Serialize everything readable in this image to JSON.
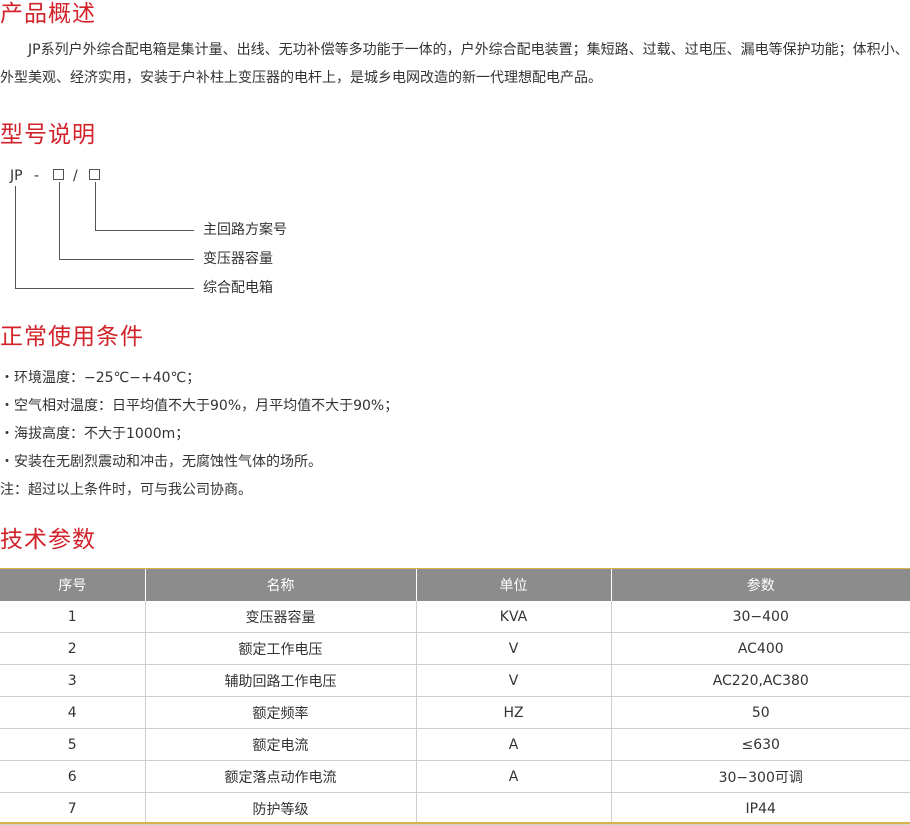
{
  "overview": {
    "heading": "产品概述",
    "text": "JP系列户外综合配电箱是集计量、出线、无功补偿等多功能于一体的，户外综合配电装置；集短路、过载、过电压、漏电等保护功能；体积小、外型美观、经济实用，安装于户补柱上变压器的电杆上，是城乡电网改造的新一代理想配电产品。"
  },
  "model": {
    "heading": "型号说明",
    "code": "JP",
    "dash": "-",
    "slash": "/",
    "labels": [
      "主回路方案号",
      "变压器容量",
      "综合配电箱"
    ]
  },
  "conditions": {
    "heading": "正常使用条件",
    "items": [
      "・环境温度：−25℃−+40℃；",
      "・空气相对温度：日平均值不大于90%，月平均值不大于90%；",
      "・海拔高度：不大于1000m；",
      "・安装在无剧烈震动和冲击，无腐蚀性气体的场所。"
    ],
    "note": "注：超过以上条件时，可与我公司协商。"
  },
  "tech": {
    "heading": "技术参数",
    "columns": [
      "序号",
      "名称",
      "单位",
      "参数"
    ],
    "rows": [
      [
        "1",
        "变压器容量",
        "KVA",
        "30−400"
      ],
      [
        "2",
        "额定工作电压",
        "V",
        "AC400"
      ],
      [
        "3",
        "辅助回路工作电压",
        "V",
        "AC220,AC380"
      ],
      [
        "4",
        "额定频率",
        "HZ",
        "50"
      ],
      [
        "5",
        "额定电流",
        "A",
        "≤630"
      ],
      [
        "6",
        "额定落点动作电流",
        "A",
        "30−300可调"
      ],
      [
        "7",
        "防护等级",
        "",
        "IP44"
      ]
    ]
  }
}
